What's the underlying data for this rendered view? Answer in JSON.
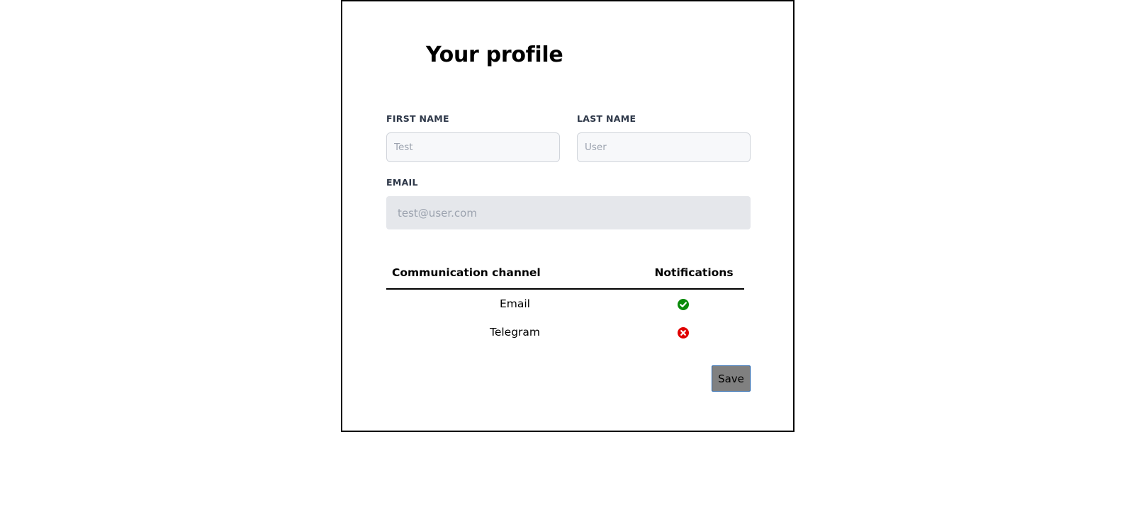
{
  "profile": {
    "title": "Your profile",
    "first_name": {
      "label": "FIRST NAME",
      "placeholder": "Test",
      "value": ""
    },
    "last_name": {
      "label": "LAST NAME",
      "placeholder": "User",
      "value": ""
    },
    "email": {
      "label": "EMAIL",
      "placeholder": "test@user.com",
      "value": ""
    }
  },
  "notifications_table": {
    "headers": {
      "channel": "Communication channel",
      "notifications": "Notifications"
    },
    "rows": [
      {
        "channel": "Email",
        "enabled": true,
        "icon": "check-circle-icon"
      },
      {
        "channel": "Telegram",
        "enabled": false,
        "icon": "x-circle-icon"
      }
    ]
  },
  "actions": {
    "save_label": "Save"
  },
  "colors": {
    "enabled": "#0a8a0a",
    "disabled": "#e00000",
    "save_button": "#808080"
  }
}
